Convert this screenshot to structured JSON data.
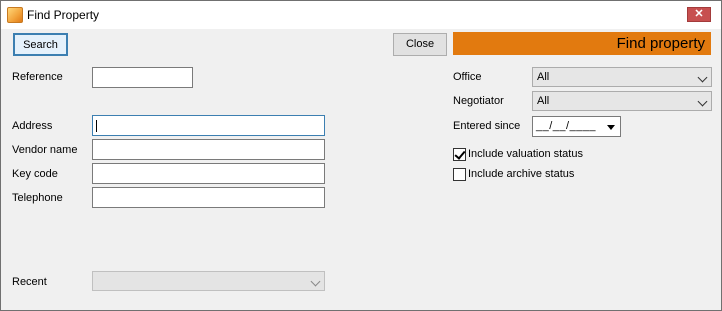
{
  "window": {
    "title": "Find Property",
    "close_glyph": "✕"
  },
  "toolbar": {
    "search_label": "Search",
    "close_label": "Close",
    "banner_title": "Find property"
  },
  "left": {
    "reference_label": "Reference",
    "address_label": "Address",
    "vendor_label": "Vendor name",
    "keycode_label": "Key code",
    "telephone_label": "Telephone",
    "recent_label": "Recent",
    "reference_value": "",
    "address_value": "",
    "vendor_value": "",
    "keycode_value": "",
    "telephone_value": "",
    "recent_value": ""
  },
  "right": {
    "office_label": "Office",
    "office_value": "All",
    "negotiator_label": "Negotiator",
    "negotiator_value": "All",
    "entered_since_label": "Entered since",
    "entered_since_value": "__/__/____",
    "include_valuation_label": "Include valuation status",
    "include_valuation_checked": true,
    "include_archive_label": "Include archive status",
    "include_archive_checked": false
  },
  "icons": {
    "app": "app-icon",
    "close": "close-icon",
    "cursor": "mouse-pointer-icon"
  },
  "colors": {
    "banner": "#e27a0f",
    "focus": "#3c7fb1",
    "close_button": "#c75050"
  }
}
